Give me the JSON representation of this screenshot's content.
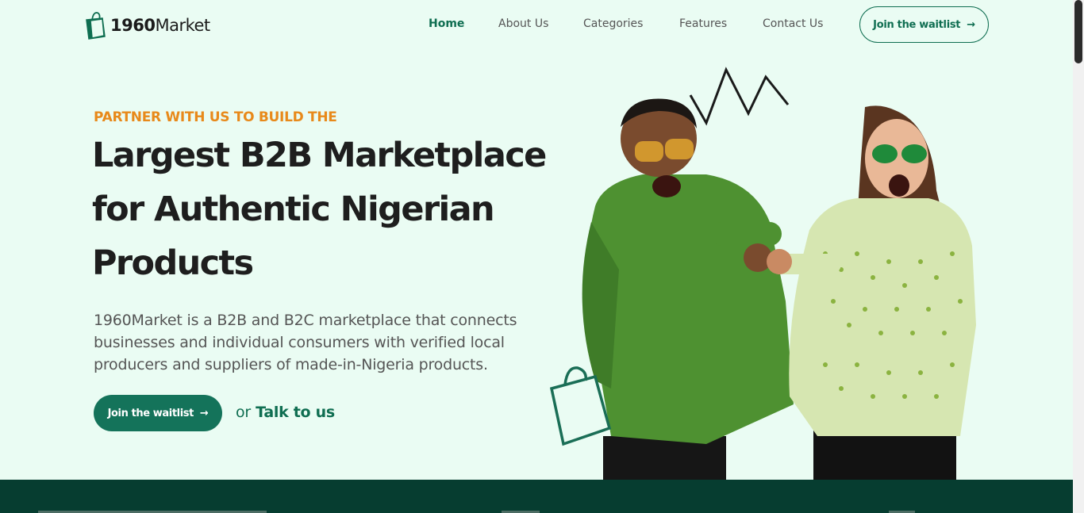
{
  "nav": {
    "logo_number": "1960",
    "logo_word": "Market",
    "links": [
      "Home",
      "About Us",
      "Categories",
      "Features",
      "Contact Us"
    ],
    "cta_label": "Join the waitlist"
  },
  "hero": {
    "eyebrow": "PARTNER WITH US TO BUILD THE",
    "headline_line1": "Largest B2B Marketplace",
    "headline_line2": "for Authentic Nigerian",
    "headline_line3": "Products",
    "description": "1960Market is a B2B and B2C marketplace that connects businesses and individual consumers with verified local producers and suppliers of made-in-Nigeria products.",
    "primary_cta": "Join the waitlist",
    "secondary_prefix": "or",
    "secondary_link": "Talk to us"
  },
  "colors": {
    "background": "#eafcf3",
    "brand": "#0f6e51",
    "accent": "#e8891a",
    "footer": "#063d30"
  },
  "icons": [
    "shopping-bag-icon",
    "arrow-right-icon",
    "zigzag-decoration"
  ]
}
